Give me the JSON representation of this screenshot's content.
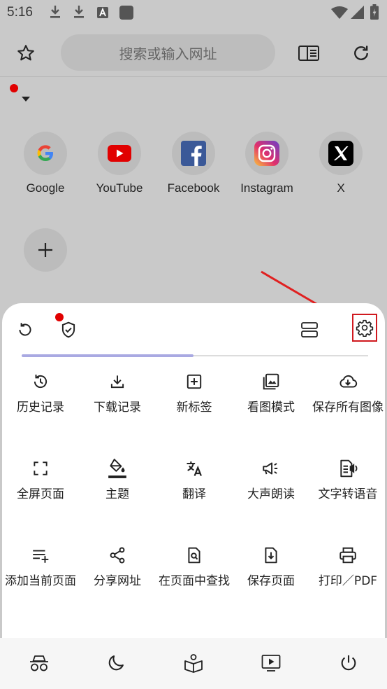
{
  "status_bar": {
    "time": "5:16"
  },
  "toolbar": {
    "search_placeholder": "搜索或输入网址"
  },
  "shortcuts": [
    {
      "label": "Google",
      "icon": "google-logo-icon"
    },
    {
      "label": "YouTube",
      "icon": "youtube-logo-icon"
    },
    {
      "label": "Facebook",
      "icon": "facebook-logo-icon"
    },
    {
      "label": "Instagram",
      "icon": "instagram-logo-icon"
    },
    {
      "label": "X",
      "icon": "x-logo-icon"
    }
  ],
  "menu": {
    "items": [
      {
        "label": "历史记录",
        "icon": "history-icon"
      },
      {
        "label": "下载记录",
        "icon": "download-icon"
      },
      {
        "label": "新标签",
        "icon": "new-tab-icon"
      },
      {
        "label": "看图模式",
        "icon": "image-icon"
      },
      {
        "label": "保存所有图像",
        "icon": "cloud-download-icon"
      },
      {
        "label": "全屏页面",
        "icon": "fullscreen-icon"
      },
      {
        "label": "主题",
        "icon": "paint-bucket-icon"
      },
      {
        "label": "翻译",
        "icon": "translate-icon"
      },
      {
        "label": "大声朗读",
        "icon": "megaphone-icon"
      },
      {
        "label": "文字转语音",
        "icon": "text-to-speech-icon"
      },
      {
        "label": "添加当前页面",
        "icon": "playlist-add-icon"
      },
      {
        "label": "分享网址",
        "icon": "share-icon"
      },
      {
        "label": "在页面中查找",
        "icon": "find-in-page-icon"
      },
      {
        "label": "保存页面",
        "icon": "save-page-icon"
      },
      {
        "label": "打印／PDF",
        "icon": "print-icon"
      }
    ]
  },
  "colors": {
    "accent": "#a9a9e2",
    "highlight": "#d0191f",
    "badge": "#e10000",
    "backdrop": "#c9c9c9"
  }
}
